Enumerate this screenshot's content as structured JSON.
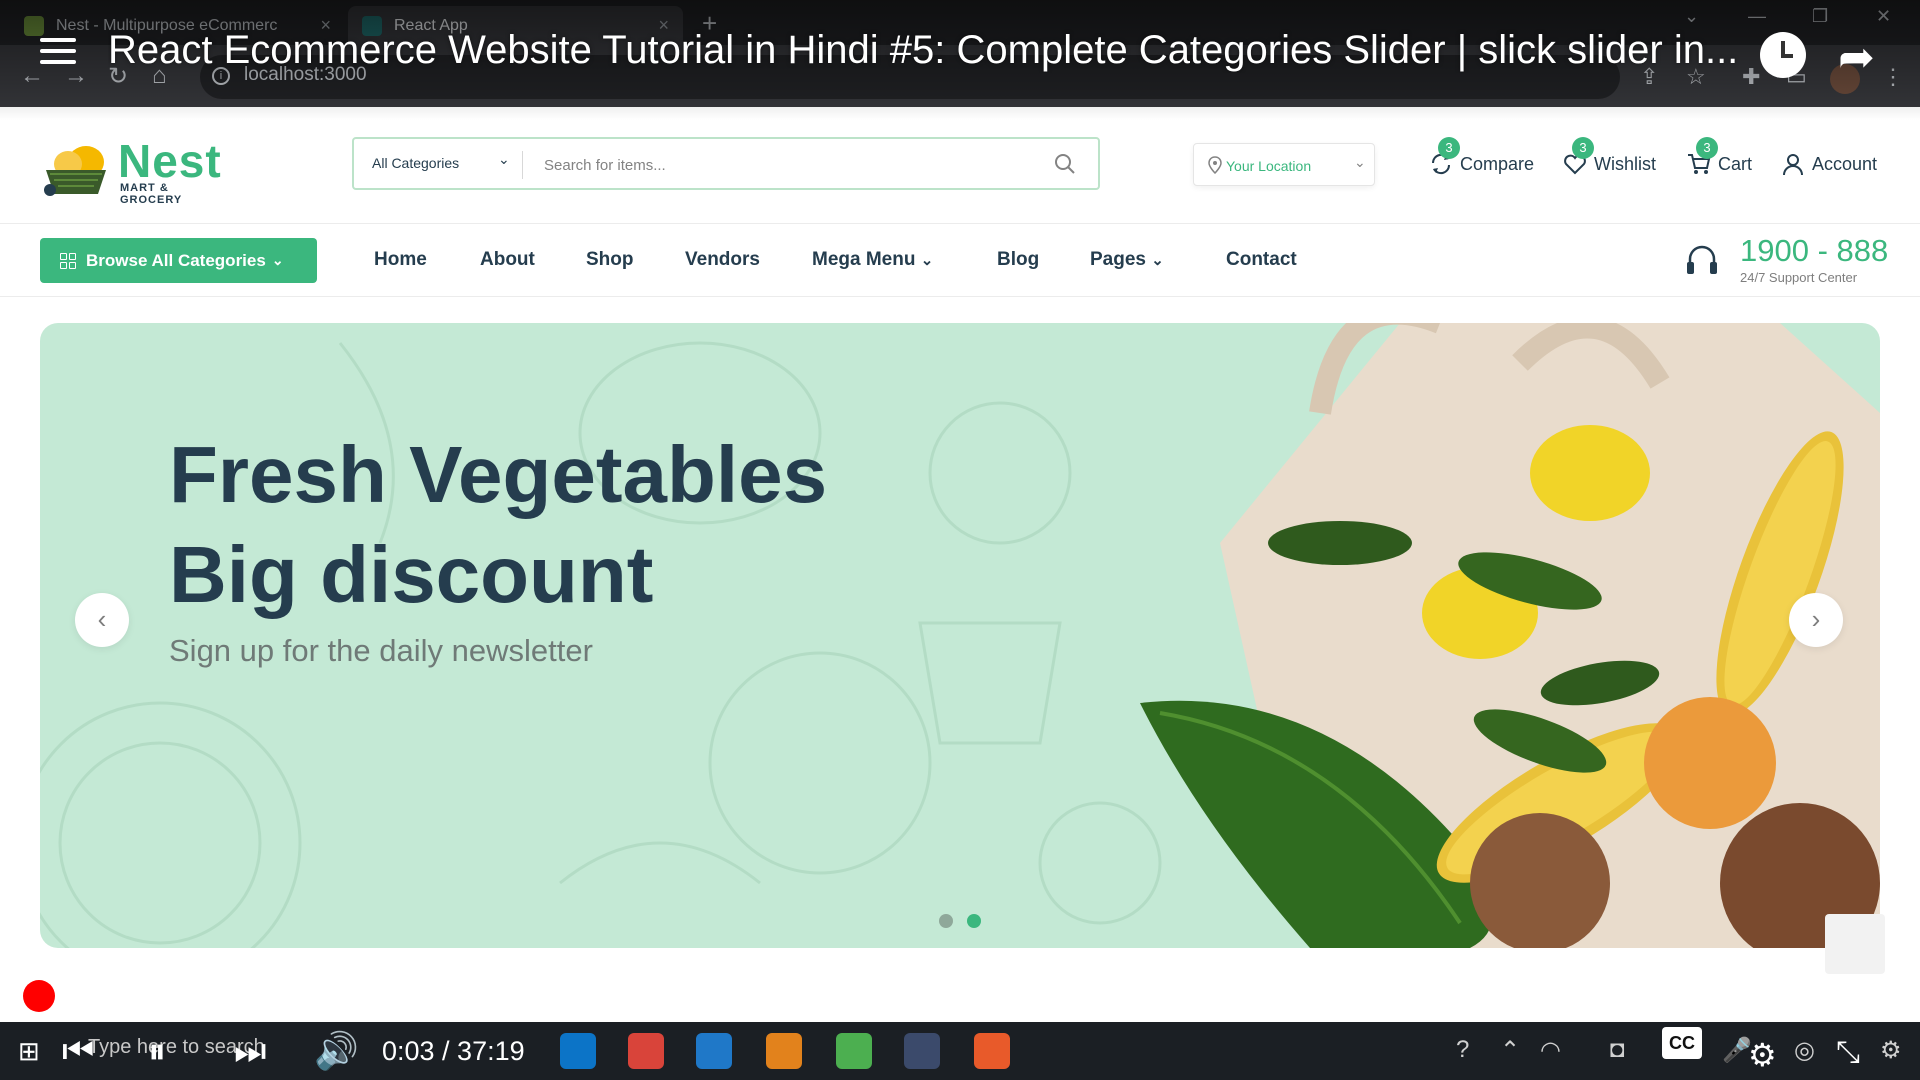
{
  "browser": {
    "tabs": [
      {
        "label": "Nest - Multipurpose eCommerc",
        "close": "×"
      },
      {
        "label": "React App",
        "close": "×"
      }
    ],
    "new_tab": "+",
    "url": "localhost:3000"
  },
  "video": {
    "title": "React Ecommerce Website Tutorial in Hindi #5: Complete Categories Slider | slick slider in...",
    "time": "0:03 / 37:19",
    "progress": 0.0013,
    "cc_label": "CC"
  },
  "site": {
    "logo": {
      "name": "Nest",
      "tagline": "MART & GROCERY"
    },
    "search": {
      "category": "All Categories",
      "placeholder": "Search for items..."
    },
    "location": {
      "label": "Your Location"
    },
    "actions": [
      {
        "label": "Compare",
        "count": "3",
        "icon": "compare-icon"
      },
      {
        "label": "Wishlist",
        "count": "3",
        "icon": "heart-icon"
      },
      {
        "label": "Cart",
        "count": "3",
        "icon": "cart-icon"
      },
      {
        "label": "Account",
        "icon": "user-icon"
      }
    ],
    "browse_label": "Browse All Categories",
    "nav": [
      {
        "label": "Home"
      },
      {
        "label": "About"
      },
      {
        "label": "Shop"
      },
      {
        "label": "Vendors"
      },
      {
        "label": "Mega Menu"
      },
      {
        "label": "Blog"
      },
      {
        "label": "Pages"
      },
      {
        "label": "Contact"
      }
    ],
    "support": {
      "phone": "1900 - 888",
      "label": "24/7 Support Center"
    },
    "hero": {
      "title_line1": "Fresh Vegetables",
      "title_line2": "Big discount",
      "subtitle": "Sign up for the daily newsletter",
      "slide_count": 2,
      "active_slide": 2
    }
  },
  "taskbar": {
    "search_placeholder": "Type here to search"
  },
  "colors": {
    "brand": "#3bb77e",
    "heading": "#253d4e",
    "hero_bg": "#c4e9d5",
    "youtube_red": "#ff0000"
  }
}
